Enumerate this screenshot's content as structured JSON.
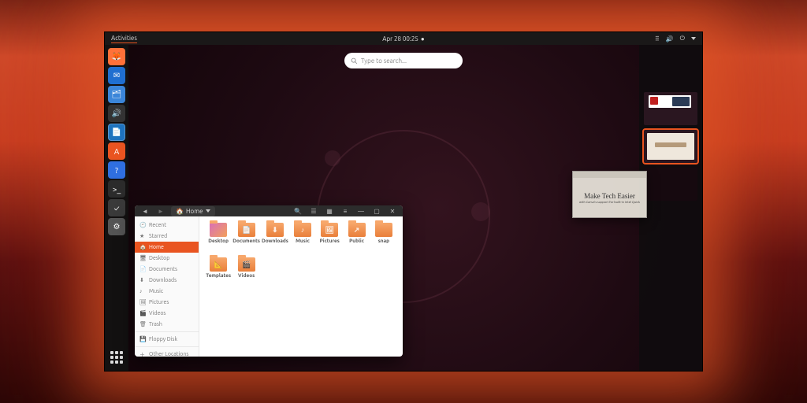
{
  "topbar": {
    "activities": "Activities",
    "datetime": "Apr 28  00:25",
    "status_dot": "●"
  },
  "search": {
    "placeholder": "Type to search..."
  },
  "dock": {
    "items": [
      {
        "name": "firefox-icon",
        "bg": "#ff7139",
        "glyph": "🦊"
      },
      {
        "name": "thunderbird-icon",
        "bg": "#1f6fd0",
        "glyph": "✉"
      },
      {
        "name": "files-icon",
        "bg": "#3b86d9",
        "glyph": "🗂"
      },
      {
        "name": "rhythmbox-icon",
        "bg": "#333",
        "glyph": "🔊"
      },
      {
        "name": "writer-icon",
        "bg": "#1e73be",
        "glyph": "📄"
      },
      {
        "name": "software-icon",
        "bg": "#e95420",
        "glyph": "A"
      },
      {
        "name": "help-icon",
        "bg": "#2f6fe0",
        "glyph": "?"
      },
      {
        "name": "terminal-icon",
        "bg": "#2b2b2b",
        "glyph": ">_"
      },
      {
        "name": "todo-icon",
        "bg": "#3a3a3a",
        "glyph": "✓"
      },
      {
        "name": "settings-icon",
        "bg": "#555",
        "glyph": "⚙"
      }
    ]
  },
  "drag_window": {
    "title": "Make Tech Easier",
    "subtitle": "with Canva's support for built-in Intel Quick"
  },
  "files": {
    "path_label": "Home",
    "sidebar": [
      {
        "label": "Recent",
        "glyph": "🕘"
      },
      {
        "label": "Starred",
        "glyph": "★"
      },
      {
        "label": "Home",
        "glyph": "🏠",
        "selected": true
      },
      {
        "label": "Desktop",
        "glyph": "🖥"
      },
      {
        "label": "Documents",
        "glyph": "📄"
      },
      {
        "label": "Downloads",
        "glyph": "⬇"
      },
      {
        "label": "Music",
        "glyph": "♪"
      },
      {
        "label": "Pictures",
        "glyph": "🖼"
      },
      {
        "label": "Videos",
        "glyph": "🎬"
      },
      {
        "label": "Trash",
        "glyph": "🗑"
      },
      {
        "label": "Floppy Disk",
        "glyph": "💾",
        "sep": true
      },
      {
        "label": "Other Locations",
        "glyph": "＋",
        "sep": true
      }
    ],
    "folders": [
      {
        "label": "Desktop",
        "plain": true
      },
      {
        "label": "Documents",
        "glyph": "📄"
      },
      {
        "label": "Downloads",
        "glyph": "⬇"
      },
      {
        "label": "Music",
        "glyph": "♪"
      },
      {
        "label": "Pictures",
        "glyph": "🖼"
      },
      {
        "label": "Public",
        "glyph": "↗"
      },
      {
        "label": "snap"
      },
      {
        "label": "Templates",
        "glyph": "📐"
      },
      {
        "label": "Videos",
        "glyph": "🎬"
      }
    ]
  },
  "workspaces": {
    "count": 3,
    "active_index": 1
  }
}
